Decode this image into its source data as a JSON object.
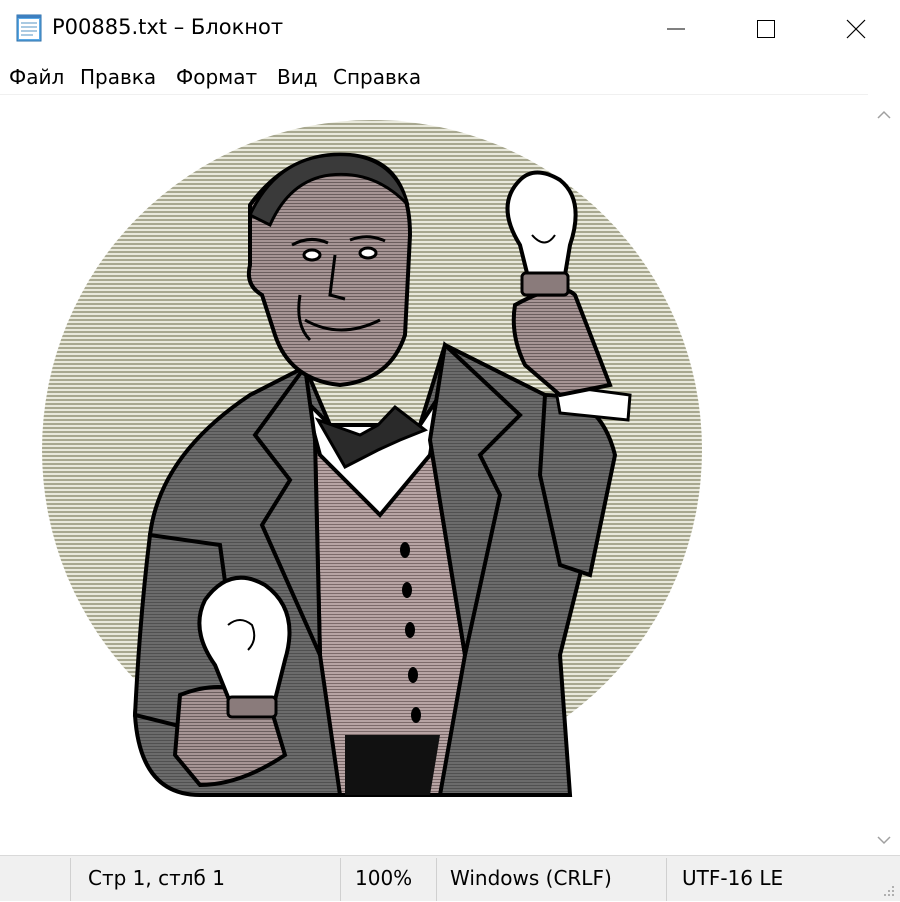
{
  "window": {
    "title": "P00885.txt – Блокнот",
    "icon": "notepad-icon",
    "controls": [
      "minimize-icon",
      "maximize-icon",
      "close-icon"
    ]
  },
  "menu": {
    "file": "Файл",
    "edit": "Правка",
    "format": "Формат",
    "view": "Вид",
    "help": "Справка"
  },
  "content": {
    "image": "illustration of a man in a suit holding two light bulbs"
  },
  "status": {
    "position": "Стр 1, стлб 1",
    "zoom": "100%",
    "line_ending": "Windows (CRLF)",
    "encoding": "UTF-16 LE"
  },
  "colors": {
    "accent_circle": "#c8c8b4",
    "suit": "#5f5f5f",
    "vest": "#9a8787",
    "skin": "#8a7b7b"
  }
}
